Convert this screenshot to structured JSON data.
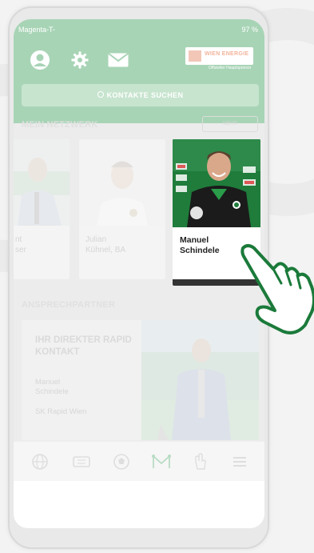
{
  "status": {
    "carrier": "Magenta-T-",
    "battery": "97 %"
  },
  "header": {
    "sponsor": {
      "name": "WIEN ENERGIE",
      "subtitle": "Offizieller Hauptsponsor"
    },
    "search_label": "KONTAKTE SUCHEN"
  },
  "network": {
    "title": "MEIN NETZWERK",
    "more_label": "MEHR",
    "cards": [
      {
        "line1": "nt",
        "line2": "ser"
      },
      {
        "line1": "Julian",
        "line2": "Kühnel, BA"
      },
      {
        "line1": "Manuel",
        "line2": "Schindele"
      }
    ]
  },
  "contacts": {
    "title": "ANSPRECHPARTNER",
    "card_title": "IHR DIREKTER RAPID KONTAKT",
    "name_line1": "Manuel",
    "name_line2": "Schindele",
    "club": "SK Rapid Wien"
  },
  "tabs": [
    "globe-icon",
    "ticket-icon",
    "football-icon",
    "network-icon",
    "hand-icon",
    "menu-icon"
  ],
  "colors": {
    "brand_green": "#1b7a3a",
    "header_overlay": "#a8d4b6"
  }
}
